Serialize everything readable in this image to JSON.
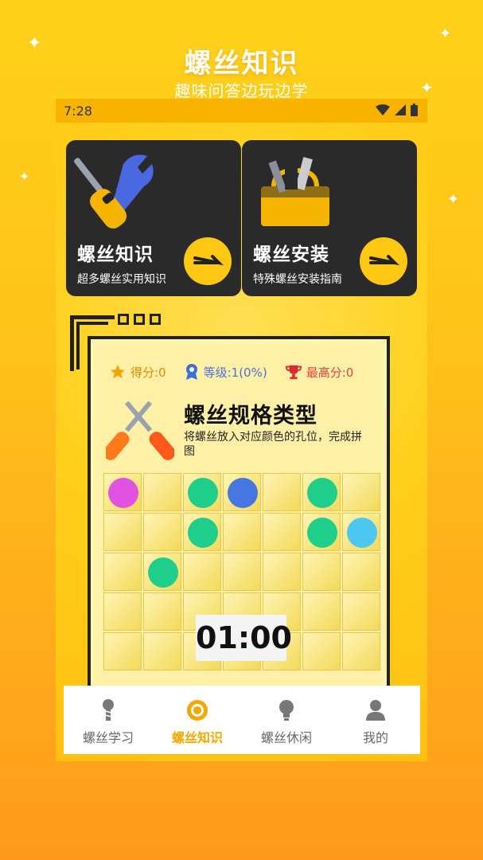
{
  "promo": {
    "title": "螺丝知识",
    "subtitle": "趣味问答边玩边学"
  },
  "status_bar": {
    "time": "7:28"
  },
  "cards": [
    {
      "title": "螺丝知识",
      "subtitle": "超多螺丝实用知识"
    },
    {
      "title": "螺丝安装",
      "subtitle": "特殊螺丝安装指南"
    }
  ],
  "game": {
    "stats": {
      "score": "得分:0",
      "level": "等级:1(0%)",
      "best": "最高分:0"
    },
    "title": "螺丝规格类型",
    "description": "将螺丝放入对应颜色的孔位，完成拼图",
    "timer": "01:00",
    "grid_dots": [
      [
        0,
        0,
        "#e052e0"
      ],
      [
        0,
        2,
        "#1fce8a"
      ],
      [
        0,
        3,
        "#4677e0"
      ],
      [
        0,
        5,
        "#1fce8a"
      ],
      [
        1,
        2,
        "#1fce8a"
      ],
      [
        1,
        5,
        "#1fce8a"
      ],
      [
        1,
        6,
        "#4cc7ef"
      ],
      [
        2,
        1,
        "#1fce8a"
      ]
    ]
  },
  "tabbar": {
    "items": [
      {
        "label": "螺丝学习",
        "icon": "screw-icon"
      },
      {
        "label": "螺丝知识",
        "icon": "target-icon"
      },
      {
        "label": "螺丝休闲",
        "icon": "lightbulb-icon"
      },
      {
        "label": "我的",
        "icon": "user-icon"
      }
    ]
  },
  "colors": {
    "accent": "#ffc814",
    "card_bg": "#2a2a2a",
    "tab_active": "#f2a800"
  }
}
